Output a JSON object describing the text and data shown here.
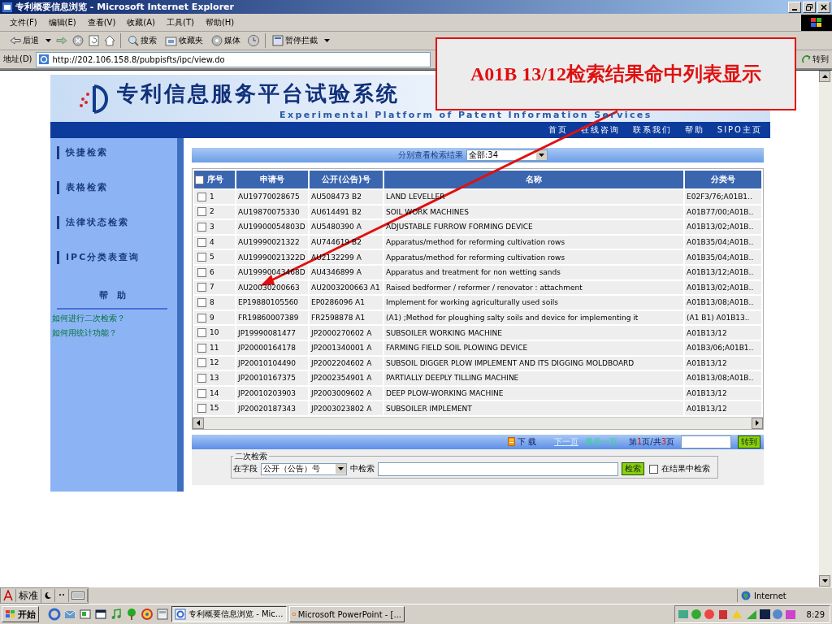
{
  "window": {
    "title": "专利概要信息浏览 - Microsoft Internet Explorer"
  },
  "menu": [
    {
      "label": "文件(F)"
    },
    {
      "label": "编辑(E)"
    },
    {
      "label": "查看(V)"
    },
    {
      "label": "收藏(A)"
    },
    {
      "label": "工具(T)"
    },
    {
      "label": "帮助(H)"
    }
  ],
  "toolbar": {
    "back": "后退",
    "search": "搜索",
    "favorites": "收藏夹",
    "media": "媒体",
    "popup_blocker": "暂停拦截"
  },
  "address": {
    "label": "地址(D)",
    "url": "http://202.106.158.8/pubpisfts/ipc/view.do",
    "go": "转到"
  },
  "site": {
    "title": "专利信息服务平台试验系统",
    "subtitle": "Experimental Platform of Patent Information Services"
  },
  "nav": [
    {
      "label": "首页"
    },
    {
      "label": "在线咨询"
    },
    {
      "label": "联系我们"
    },
    {
      "label": "帮助"
    },
    {
      "label": "SIPO主页"
    }
  ],
  "sidebar": {
    "items": [
      {
        "label": "快捷检索"
      },
      {
        "label": "表格检索"
      },
      {
        "label": "法律状态检索"
      },
      {
        "label": "IPC分类表查询"
      }
    ],
    "help_title": "帮　助",
    "help_links": [
      {
        "label": "如何进行二次检索？"
      },
      {
        "label": "如何用统计功能？"
      }
    ]
  },
  "results": {
    "filter_label": "分别查看检索结果",
    "filter_value": "全部:34",
    "columns": [
      "序号",
      "申请号",
      "公开(公告)号",
      "名称",
      "分类号"
    ],
    "header_checked": false,
    "rows": [
      {
        "checked": false,
        "no": "1",
        "application": "AU19770028675",
        "publication": "AU508473 B2",
        "title": "LAND LEVELLER",
        "class": "E02F3/76;A01B1.."
      },
      {
        "checked": false,
        "no": "2",
        "application": "AU19870075330",
        "publication": "AU614491 B2",
        "title": "SOIL WORK MACHINES",
        "class": "A01B77/00;A01B.."
      },
      {
        "checked": false,
        "no": "3",
        "application": "AU19900054803D",
        "publication": "AU5480390 A",
        "title": "ADJUSTABLE FURROW FORMING DEVICE",
        "class": "A01B13/02;A01B.."
      },
      {
        "checked": false,
        "no": "4",
        "application": "AU19990021322",
        "publication": "AU744619 B2",
        "title": "Apparatus/method for reforming cultivation rows",
        "class": "A01B35/04;A01B.."
      },
      {
        "checked": false,
        "no": "5",
        "application": "AU19990021322D",
        "publication": "AU2132299 A",
        "title": "Apparatus/method for reforming cultivation rows",
        "class": "A01B35/04;A01B.."
      },
      {
        "checked": false,
        "no": "6",
        "application": "AU19990043468D",
        "publication": "AU4346899 A",
        "title": "Apparatus and treatment for non wetting sands",
        "class": "A01B13/12;A01B.."
      },
      {
        "checked": false,
        "no": "7",
        "application": "AU20030200663",
        "publication": "AU2003200663 A1",
        "title": "Raised bedformer / reformer / renovator : attachment",
        "class": "A01B13/02;A01B.."
      },
      {
        "checked": false,
        "no": "8",
        "application": "EP19880105560",
        "publication": "EP0286096 A1",
        "title": "Implement for working agriculturally used soils",
        "class": "A01B13/08;A01B.."
      },
      {
        "checked": false,
        "no": "9",
        "application": "FR19860007389",
        "publication": "FR2598878 A1",
        "title": "(A1) ;Method for ploughing salty soils and device for implementing it",
        "class": "(A1 B1) A01B13.."
      },
      {
        "checked": false,
        "no": "10",
        "application": "JP19990081477",
        "publication": "JP2000270602 A",
        "title": "SUBSOILER WORKING MACHINE",
        "class": "A01B13/12"
      },
      {
        "checked": false,
        "no": "11",
        "application": "JP20000164178",
        "publication": "JP2001340001 A",
        "title": "FARMING FIELD SOIL PLOWING DEVICE",
        "class": "A01B3/06;A01B1.."
      },
      {
        "checked": false,
        "no": "12",
        "application": "JP20010104490",
        "publication": "JP2002204602 A",
        "title": "SUBSOIL DIGGER PLOW IMPLEMENT AND ITS DIGGING MOLDBOARD",
        "class": "A01B13/12"
      },
      {
        "checked": false,
        "no": "13",
        "application": "JP20010167375",
        "publication": "JP2002354901 A",
        "title": "PARTIALLY DEEPLY TILLING MACHINE",
        "class": "A01B13/08;A01B.."
      },
      {
        "checked": false,
        "no": "14",
        "application": "JP20010203903",
        "publication": "JP2003009602 A",
        "title": "DEEP PLOW-WORKING MACHINE",
        "class": "A01B13/12"
      },
      {
        "checked": false,
        "no": "15",
        "application": "JP20020187343",
        "publication": "JP2003023802 A",
        "title": "SUBSOILER IMPLEMENT",
        "class": "A01B13/12"
      }
    ]
  },
  "pager": {
    "download": "下 载",
    "next": "下一页",
    "last": "最后一页",
    "prefix": "第",
    "current": "1",
    "middle": "页/共",
    "total": "3",
    "suffix": "页",
    "go": "转到"
  },
  "secondary_search": {
    "legend": "二次检索",
    "field_label": "在字段",
    "field_value": "公开（公告）号",
    "in_label": "中检索",
    "button": "检索",
    "within_results": {
      "label": "在结果中检索",
      "checked": false
    }
  },
  "status_bar": {
    "zone": "Internet"
  },
  "ime": {
    "mode": "标准"
  },
  "taskbar": {
    "start": "开始",
    "tasks": [
      {
        "label": "专利概要信息浏览 - Mic...",
        "selected": true
      },
      {
        "label": "Microsoft PowerPoint - [...",
        "selected": false
      }
    ],
    "clock": "8:29"
  },
  "annotation": {
    "text": "A01B 13/12检索结果命中列表显示"
  }
}
